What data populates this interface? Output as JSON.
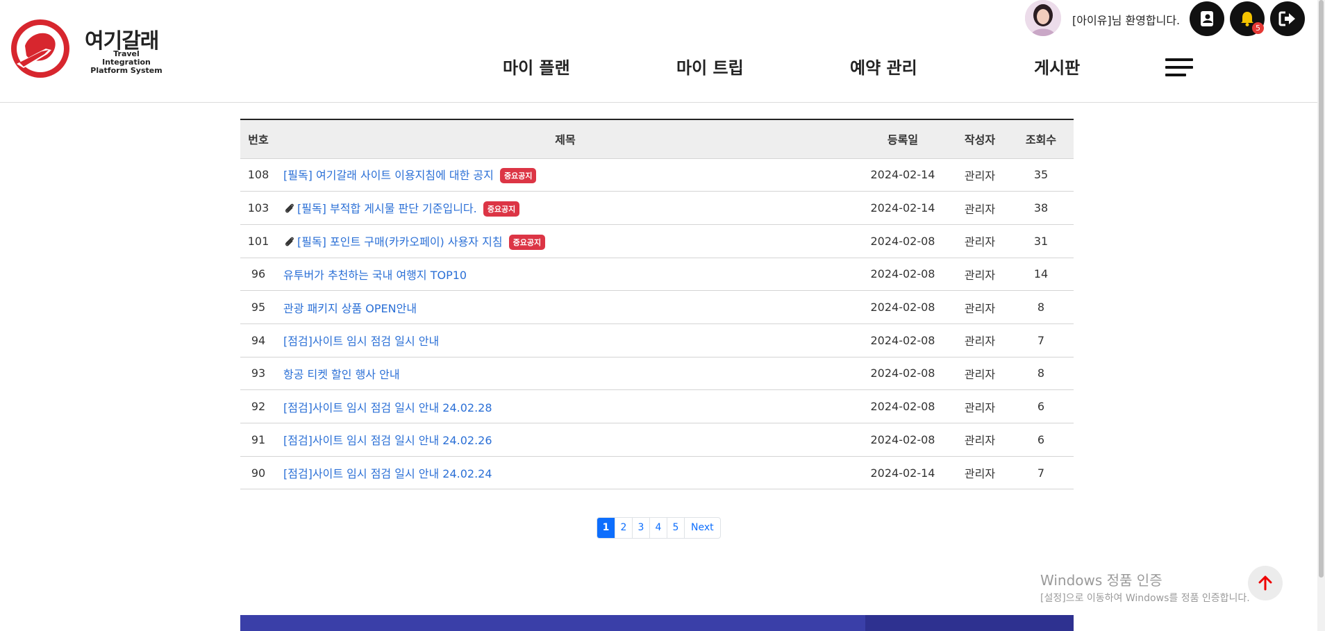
{
  "header": {
    "logo_title": "여기갈래",
    "logo_sub_line1": "Travel Integration",
    "logo_sub_line2": "Platform System",
    "nav": [
      "마이 플랜",
      "마이 트립",
      "예약 관리",
      "게시판"
    ],
    "welcome": "[아이유]님 환영합니다.",
    "notification_count": "5"
  },
  "table": {
    "headers": {
      "num": "번호",
      "title": "제목",
      "date": "등록일",
      "writer": "작성자",
      "views": "조회수"
    },
    "rows": [
      {
        "num": "108",
        "title": "[필독] 여기갈래 사이트 이용지침에 대한 공지",
        "attachment": false,
        "tag": "중요공지",
        "date": "2024-02-14",
        "writer": "관리자",
        "views": "35"
      },
      {
        "num": "103",
        "title": "[필독] 부적합 게시물 판단 기준입니다.",
        "attachment": true,
        "tag": "중요공지",
        "date": "2024-02-14",
        "writer": "관리자",
        "views": "38"
      },
      {
        "num": "101",
        "title": "[필독] 포인트 구매(카카오페이) 사용자 지침",
        "attachment": true,
        "tag": "중요공지",
        "date": "2024-02-08",
        "writer": "관리자",
        "views": "31"
      },
      {
        "num": "96",
        "title": "유투버가 추천하는 국내 여행지 TOP10",
        "attachment": false,
        "tag": "",
        "date": "2024-02-08",
        "writer": "관리자",
        "views": "14"
      },
      {
        "num": "95",
        "title": "관광 패키지 상품 OPEN안내",
        "attachment": false,
        "tag": "",
        "date": "2024-02-08",
        "writer": "관리자",
        "views": "8"
      },
      {
        "num": "94",
        "title": "[점검]사이트 임시 점검 일시 안내",
        "attachment": false,
        "tag": "",
        "date": "2024-02-08",
        "writer": "관리자",
        "views": "7"
      },
      {
        "num": "93",
        "title": "항공 티켓 할인 행사 안내",
        "attachment": false,
        "tag": "",
        "date": "2024-02-08",
        "writer": "관리자",
        "views": "8"
      },
      {
        "num": "92",
        "title": "[점검]사이트 임시 점검 일시 안내 24.02.28",
        "attachment": false,
        "tag": "",
        "date": "2024-02-08",
        "writer": "관리자",
        "views": "6"
      },
      {
        "num": "91",
        "title": "[점검]사이트 임시 점검 일시 안내 24.02.26",
        "attachment": false,
        "tag": "",
        "date": "2024-02-08",
        "writer": "관리자",
        "views": "6"
      },
      {
        "num": "90",
        "title": "[점검]사이트 임시 점검 일시 안내 24.02.24",
        "attachment": false,
        "tag": "",
        "date": "2024-02-14",
        "writer": "관리자",
        "views": "7"
      }
    ]
  },
  "pagination": {
    "pages": [
      "1",
      "2",
      "3",
      "4",
      "5"
    ],
    "active": "1",
    "next_label": "Next"
  },
  "watermark": {
    "title": "Windows 정품 인증",
    "subtitle": "[설정]으로 이동하여 Windows를 정품 인증합니다."
  },
  "colors": {
    "link": "#2a6fd6",
    "tag": "#dc3545",
    "brand_red": "#d7262e",
    "footer": "#3a3fa8",
    "active_page": "#0d6efd"
  }
}
